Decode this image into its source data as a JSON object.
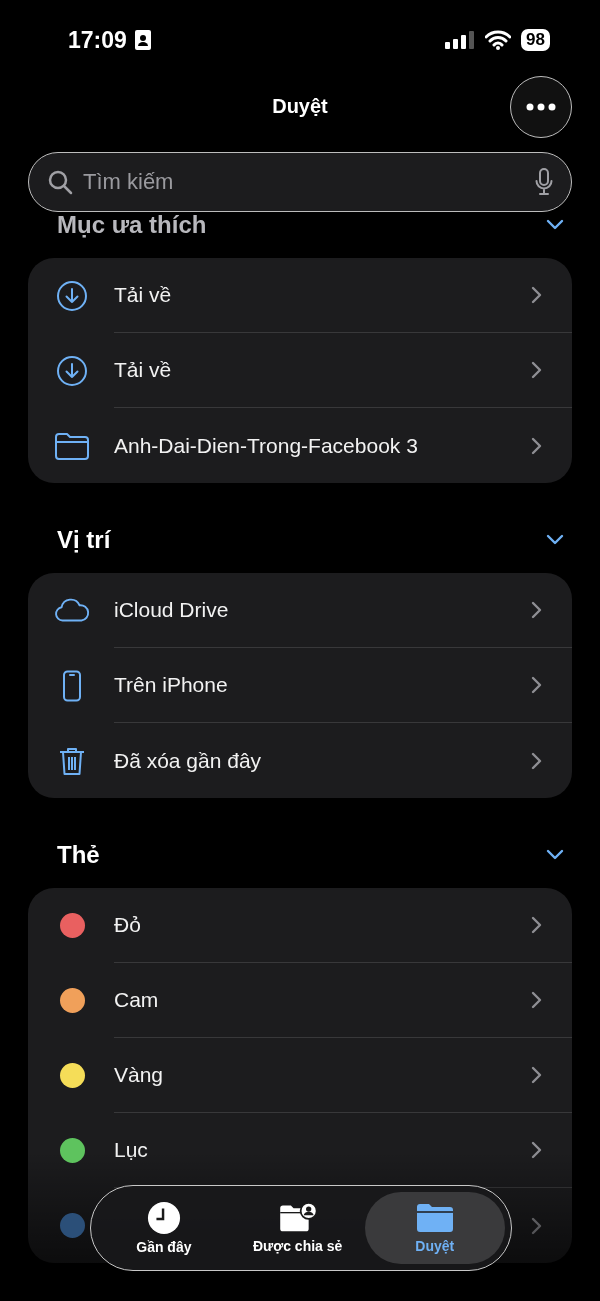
{
  "status_bar": {
    "time": "17:09",
    "battery": "98"
  },
  "nav": {
    "title": "Duyệt"
  },
  "search": {
    "placeholder": "Tìm kiếm"
  },
  "sections": [
    {
      "title": "Mục ưa thích",
      "expanded": true,
      "items": [
        {
          "kind": "download",
          "label": "Tải về"
        },
        {
          "kind": "download",
          "label": "Tải về"
        },
        {
          "kind": "folder",
          "label": "Anh-Dai-Dien-Trong-Facebook 3"
        }
      ]
    },
    {
      "title": "Vị trí",
      "expanded": true,
      "items": [
        {
          "kind": "cloud",
          "label": "iCloud Drive"
        },
        {
          "kind": "phone",
          "label": "Trên iPhone"
        },
        {
          "kind": "trash",
          "label": "Đã xóa gần đây"
        }
      ]
    },
    {
      "title": "Thẻ",
      "expanded": true,
      "items": [
        {
          "kind": "tag",
          "label": "Đỏ",
          "color": "#e96060"
        },
        {
          "kind": "tag",
          "label": "Cam",
          "color": "#f0a05a"
        },
        {
          "kind": "tag",
          "label": "Vàng",
          "color": "#f5dd58"
        },
        {
          "kind": "tag",
          "label": "Lục",
          "color": "#5ec35e"
        },
        {
          "kind": "tag",
          "color": "#2b4f78"
        }
      ]
    }
  ],
  "tab_bar": {
    "tabs": [
      {
        "kind": "recent",
        "label": "Gần đây",
        "selected": false
      },
      {
        "kind": "shared",
        "label": "Được chia sẻ",
        "selected": false
      },
      {
        "kind": "browse",
        "label": "Duyệt",
        "selected": true
      }
    ]
  }
}
